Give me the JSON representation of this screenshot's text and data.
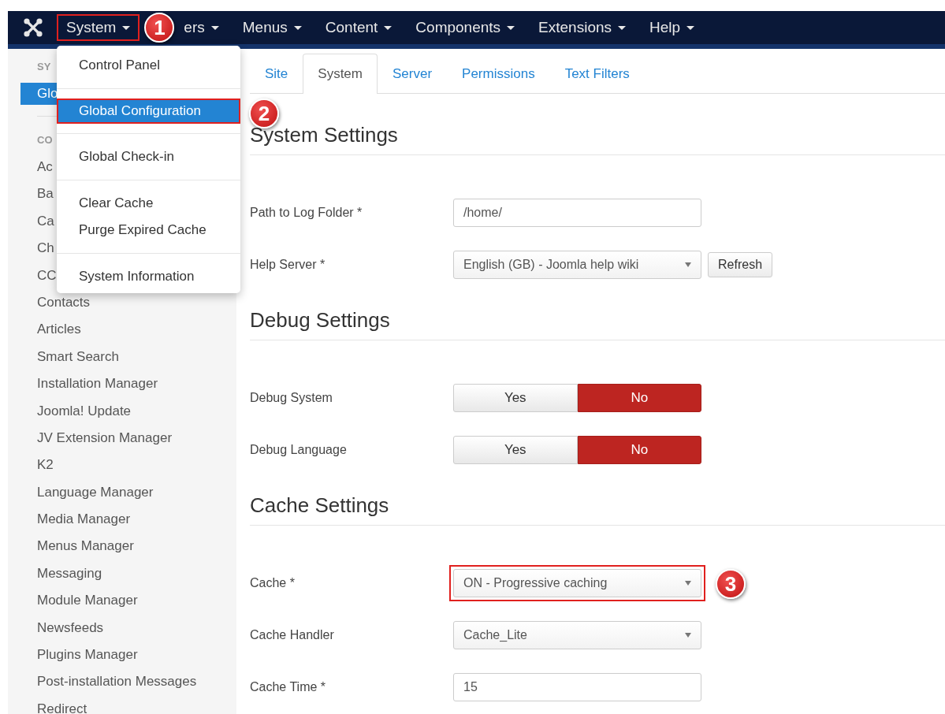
{
  "navbar": {
    "menus": [
      {
        "label": "System",
        "highlighted": true,
        "badge": "1"
      },
      {
        "label": "ers",
        "highlighted": false
      },
      {
        "label": "Menus",
        "highlighted": false
      },
      {
        "label": "Content",
        "highlighted": false
      },
      {
        "label": "Components",
        "highlighted": false
      },
      {
        "label": "Extensions",
        "highlighted": false
      },
      {
        "label": "Help",
        "highlighted": false
      }
    ]
  },
  "dropdown": {
    "groups": [
      [
        {
          "label": "Control Panel",
          "selected": false,
          "highlighted": false
        }
      ],
      [
        {
          "label": "Global Configuration",
          "selected": true,
          "highlighted": true,
          "badge": "2"
        }
      ],
      [
        {
          "label": "Global Check-in",
          "selected": false,
          "highlighted": false
        }
      ],
      [
        {
          "label": "Clear Cache",
          "selected": false,
          "highlighted": false
        },
        {
          "label": "Purge Expired Cache",
          "selected": false,
          "highlighted": false
        }
      ],
      [
        {
          "label": "System Information",
          "selected": false,
          "highlighted": false
        }
      ]
    ]
  },
  "sidebar": {
    "items": [
      {
        "kind": "header",
        "label": "SY"
      },
      {
        "kind": "link",
        "label": "Glo",
        "selected": true
      },
      {
        "kind": "divider"
      },
      {
        "kind": "header",
        "label": "CO"
      },
      {
        "kind": "link",
        "label": "Ac",
        "selected": false
      },
      {
        "kind": "link",
        "label": "Ba",
        "selected": false
      },
      {
        "kind": "link",
        "label": "Ca",
        "selected": false
      },
      {
        "kind": "link",
        "label": "Ch",
        "selected": false
      },
      {
        "kind": "link",
        "label": "CC",
        "selected": false
      },
      {
        "kind": "link",
        "label": "Contacts",
        "selected": false
      },
      {
        "kind": "link",
        "label": "Articles",
        "selected": false
      },
      {
        "kind": "link",
        "label": "Smart Search",
        "selected": false
      },
      {
        "kind": "link",
        "label": "Installation Manager",
        "selected": false
      },
      {
        "kind": "link",
        "label": "Joomla! Update",
        "selected": false
      },
      {
        "kind": "link",
        "label": "JV Extension Manager",
        "selected": false
      },
      {
        "kind": "link",
        "label": "K2",
        "selected": false
      },
      {
        "kind": "link",
        "label": "Language Manager",
        "selected": false
      },
      {
        "kind": "link",
        "label": "Media Manager",
        "selected": false
      },
      {
        "kind": "link",
        "label": "Menus Manager",
        "selected": false
      },
      {
        "kind": "link",
        "label": "Messaging",
        "selected": false
      },
      {
        "kind": "link",
        "label": "Module Manager",
        "selected": false
      },
      {
        "kind": "link",
        "label": "Newsfeeds",
        "selected": false
      },
      {
        "kind": "link",
        "label": "Plugins Manager",
        "selected": false
      },
      {
        "kind": "link",
        "label": "Post-installation Messages",
        "selected": false
      },
      {
        "kind": "link",
        "label": "Redirect",
        "selected": false
      }
    ]
  },
  "tabs": [
    {
      "label": "Site",
      "selected": false
    },
    {
      "label": "System",
      "selected": true
    },
    {
      "label": "Server",
      "selected": false
    },
    {
      "label": "Permissions",
      "selected": false
    },
    {
      "label": "Text Filters",
      "selected": false
    }
  ],
  "sections": [
    {
      "title": "System Settings",
      "fields": [
        {
          "kind": "text",
          "label": "Path to Log Folder *",
          "value": "/home/",
          "highlighted": false
        },
        {
          "kind": "select",
          "label": "Help Server *",
          "value": "English (GB) - Joomla help wiki",
          "button": "Refresh",
          "highlighted": false
        }
      ]
    },
    {
      "title": "Debug Settings",
      "fields": [
        {
          "kind": "toggle",
          "label": "Debug System",
          "options": [
            {
              "label": "Yes",
              "selected": false
            },
            {
              "label": "No",
              "selected": true
            }
          ]
        },
        {
          "kind": "toggle",
          "label": "Debug Language",
          "options": [
            {
              "label": "Yes",
              "selected": false
            },
            {
              "label": "No",
              "selected": true
            }
          ]
        }
      ]
    },
    {
      "title": "Cache Settings",
      "fields": [
        {
          "kind": "select",
          "label": "Cache *",
          "value": "ON - Progressive caching",
          "highlighted": true,
          "badge": "3"
        },
        {
          "kind": "select",
          "label": "Cache Handler",
          "value": "Cache_Lite",
          "highlighted": false
        },
        {
          "kind": "text",
          "label": "Cache Time *",
          "value": "15",
          "highlighted": false
        }
      ]
    }
  ]
}
